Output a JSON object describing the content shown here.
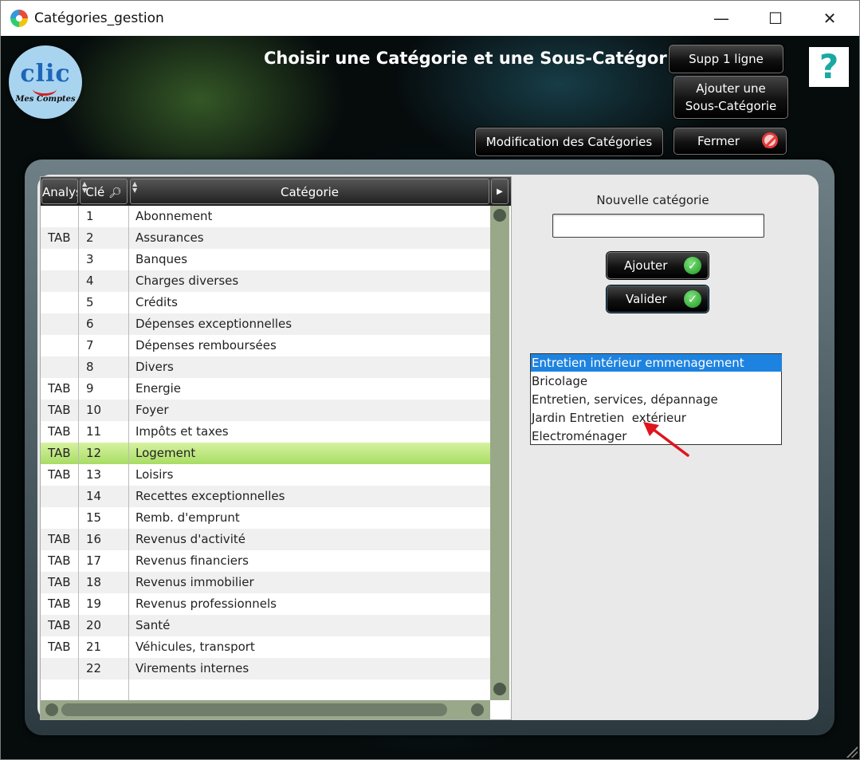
{
  "window": {
    "title": "Catégories_gestion",
    "minimize": "—",
    "maximize": "☐",
    "close": "✕"
  },
  "logo": {
    "word": "clic",
    "sub": "Mes Comptes"
  },
  "header": {
    "title": "Choisir une Catégorie et une Sous-Catégorie",
    "help": "?"
  },
  "buttons": {
    "supp": "Supp 1 ligne",
    "add_sub_1": "Ajouter une",
    "add_sub_2": "Sous-Catégorie",
    "modif": "Modification des Catégories",
    "close": "Fermer",
    "ajouter": "Ajouter",
    "valider": "Valider"
  },
  "table": {
    "columns": [
      "Analyse",
      "Clé",
      "Catégorie"
    ],
    "selected_index": 11,
    "rows": [
      {
        "analyse": "",
        "cle": "1",
        "categorie": "Abonnement"
      },
      {
        "analyse": "TAB",
        "cle": "2",
        "categorie": "Assurances"
      },
      {
        "analyse": "",
        "cle": "3",
        "categorie": "Banques"
      },
      {
        "analyse": "",
        "cle": "4",
        "categorie": "Charges diverses"
      },
      {
        "analyse": "",
        "cle": "5",
        "categorie": "Crédits"
      },
      {
        "analyse": "",
        "cle": "6",
        "categorie": "Dépenses exceptionnelles"
      },
      {
        "analyse": "",
        "cle": "7",
        "categorie": "Dépenses remboursées"
      },
      {
        "analyse": "",
        "cle": "8",
        "categorie": "Divers"
      },
      {
        "analyse": "TAB",
        "cle": "9",
        "categorie": "Energie"
      },
      {
        "analyse": "TAB",
        "cle": "10",
        "categorie": "Foyer"
      },
      {
        "analyse": "TAB",
        "cle": "11",
        "categorie": "Impôts et taxes"
      },
      {
        "analyse": "TAB",
        "cle": "12",
        "categorie": "Logement"
      },
      {
        "analyse": "TAB",
        "cle": "13",
        "categorie": "Loisirs"
      },
      {
        "analyse": "",
        "cle": "14",
        "categorie": "Recettes exceptionnelles"
      },
      {
        "analyse": "",
        "cle": "15",
        "categorie": "Remb. d'emprunt"
      },
      {
        "analyse": "TAB",
        "cle": "16",
        "categorie": "Revenus d'activité"
      },
      {
        "analyse": "TAB",
        "cle": "17",
        "categorie": "Revenus financiers"
      },
      {
        "analyse": "TAB",
        "cle": "18",
        "categorie": "Revenus immobilier"
      },
      {
        "analyse": "TAB",
        "cle": "19",
        "categorie": "Revenus professionnels"
      },
      {
        "analyse": "TAB",
        "cle": "20",
        "categorie": "Santé"
      },
      {
        "analyse": "TAB",
        "cle": "21",
        "categorie": "Véhicules, transport"
      },
      {
        "analyse": "",
        "cle": "22",
        "categorie": "Virements internes"
      }
    ]
  },
  "form": {
    "new_category_label": "Nouvelle catégorie",
    "new_category_value": ""
  },
  "subcategories": {
    "selected_index": 0,
    "items": [
      "Entretien intérieur emmenagement",
      "Bricolage",
      "Entretien, services, dépannage",
      "Jardin Entretien  extérieur",
      "Electroménager"
    ]
  },
  "colors": {
    "selected_row": "#a8dc64",
    "list_selection": "#1e83e0",
    "annotation_arrow": "#e0141e"
  }
}
